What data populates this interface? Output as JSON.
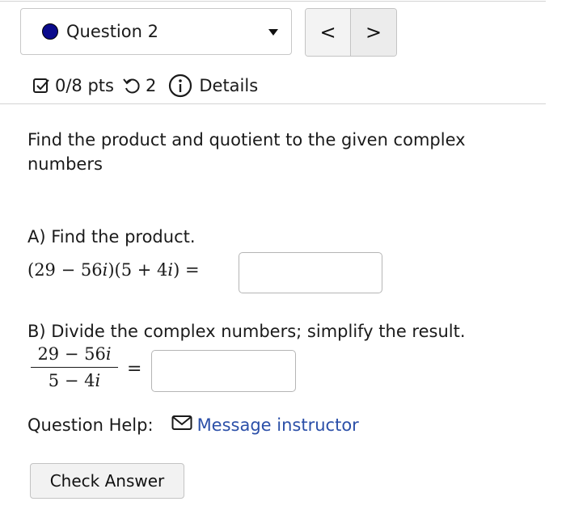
{
  "question_nav": {
    "selected_question": "Question 2",
    "status_dot_color": "#0b0b8c",
    "prev_symbol": "<",
    "next_symbol": ">"
  },
  "meta": {
    "points": "0/8 pts",
    "attempts": "2",
    "details_label": "Details"
  },
  "question": {
    "prompt": "Find the product and quotient to the given complex numbers",
    "part_a": {
      "label": "A) Find the product.",
      "expression": {
        "open1": "(29 − 56",
        "i1": "i",
        "mid": ")(5 + 4",
        "i2": "i",
        "close": ") ="
      },
      "answer_value": ""
    },
    "part_b": {
      "label": "B) Divide the complex numbers; simplify the result.",
      "numerator": {
        "text": "29 − 56",
        "i": "i"
      },
      "denominator": {
        "text": "5 − 4",
        "i": "i"
      },
      "equals": "=",
      "answer_value": ""
    }
  },
  "help": {
    "label": "Question Help:",
    "message_link": "Message instructor",
    "link_color": "#2b4fa8"
  },
  "actions": {
    "check_answer": "Check Answer"
  }
}
